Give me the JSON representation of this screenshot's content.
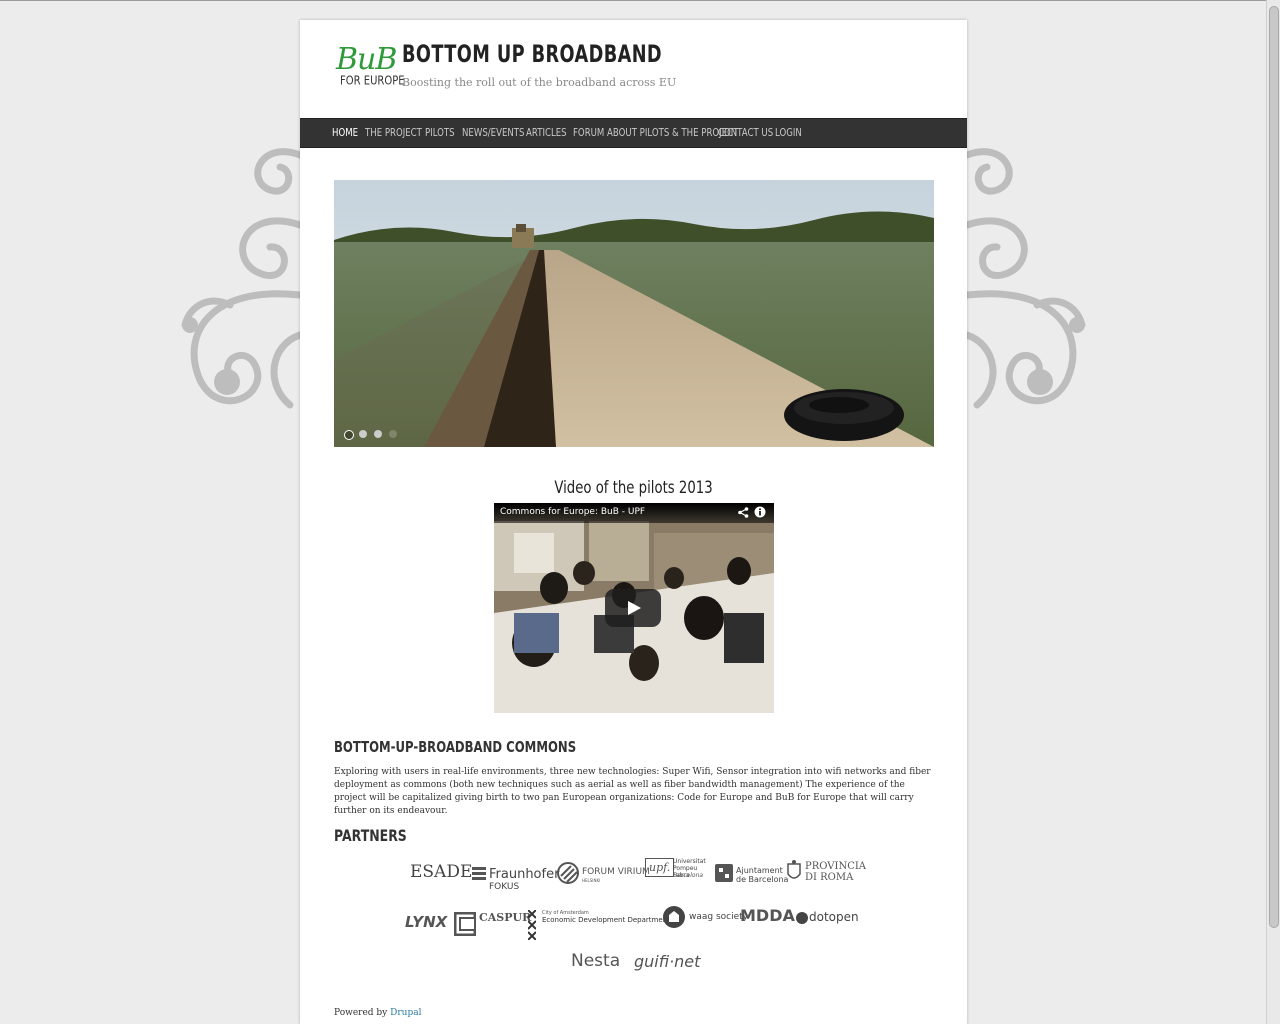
{
  "site": {
    "logo_text": "BuB",
    "logo_subtext": "FOR EUROPE",
    "title": "BOTTOM UP BROADBAND",
    "slogan": "Boosting the roll out of the broadband across EU"
  },
  "nav": {
    "items": [
      {
        "label": "HOME",
        "active": true
      },
      {
        "label": "THE PROJECT"
      },
      {
        "label": "PILOTS"
      },
      {
        "label": "NEWS/EVENTS"
      },
      {
        "label": "ARTICLES"
      },
      {
        "label": "FORUM ABOUT PILOTS & THE PROJECT"
      },
      {
        "label": "CONTACT US"
      },
      {
        "label": "LOGIN"
      }
    ]
  },
  "slider": {
    "slide_count": 4,
    "active_slide": 1
  },
  "video": {
    "heading": "Video of the pilots 2013",
    "title": "Commons for Europe: BuB - UPF",
    "icons": [
      "share-icon",
      "info-icon",
      "play-icon"
    ]
  },
  "commons": {
    "heading": "BOTTOM-UP-BROADBAND COMMONS",
    "text": "Exploring with users in real-life environments, three new technologies: Super Wifi, Sensor integration into wifi networks and fiber deployment as commons (both new techniques such as aerial as well as fiber bandwidth management) The experience of the project will be capitalized giving birth to two pan European organizations: Code for Europe and BuB for Europe that will carry further on its endeavour."
  },
  "partners": {
    "heading": "PARTNERS",
    "logos": {
      "esade": "ESADE",
      "fraunhofer": "Fraunhofer",
      "fraunhofer_sub": "FOKUS",
      "forum_virium": "FORUM VIRIUM",
      "forum_virium_sub": "HELSINKI",
      "upf_mark": "upf.",
      "upf": "Universitat Pompeu Fabra",
      "upf_city": "Barcelona",
      "ajuntament": "Ajuntament",
      "ajuntament_sub": "de Barcelona",
      "provincia": "PROVINCIA",
      "provincia_sub": "DI ROMA",
      "lynx": "LYNX",
      "caspur": "CASPUR",
      "amsterdam_small": "City of Amsterdam",
      "amsterdam": "Economic Development Department",
      "waag": "waag society",
      "mdda": "MDDA",
      "dotopen": "dotopen",
      "nesta": "Nesta",
      "guifi": "guifi·net"
    }
  },
  "footer": {
    "prefix": "Powered by",
    "link": "Drupal"
  },
  "colors": {
    "nav_bg": "#333333",
    "logo_green": "#2f9a3a",
    "link": "#2a7aa0"
  }
}
